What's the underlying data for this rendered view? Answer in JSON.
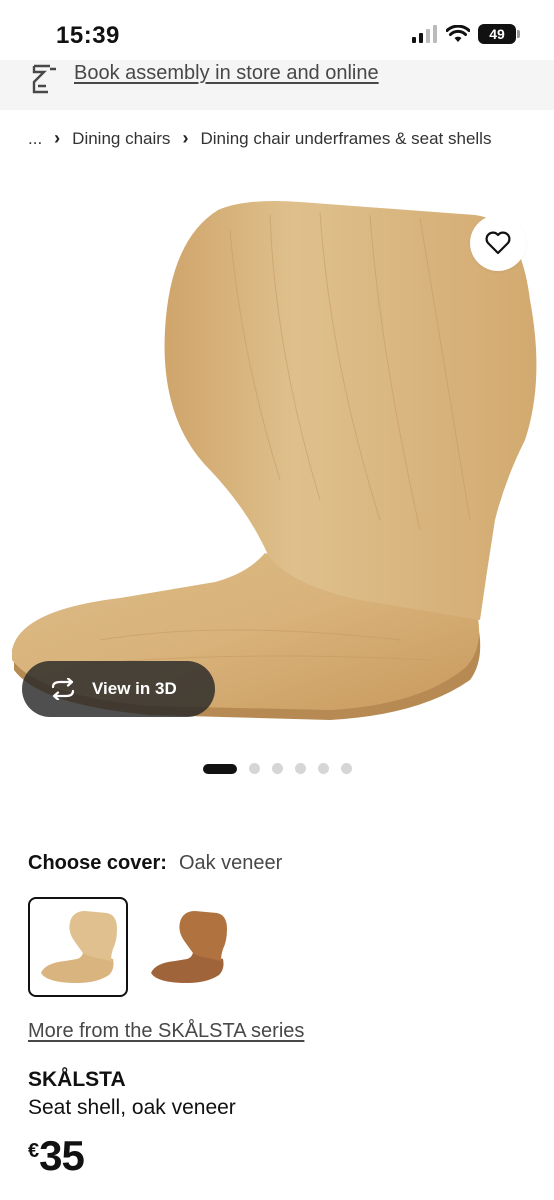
{
  "status_bar": {
    "time": "15:39",
    "battery": "49",
    "icons": [
      "signal-icon",
      "wifi-icon",
      "battery-icon"
    ]
  },
  "assembly": {
    "icon": "assembly-icon",
    "link": "Book assembly in store and online"
  },
  "breadcrumb": {
    "ellipsis": "...",
    "items": [
      "Dining chairs",
      "Dining chair underframes & seat shells"
    ]
  },
  "gallery": {
    "wishlist_icon": "heart-icon",
    "view3d_label": "View in 3D",
    "view3d_icon": "rotate-3d-icon",
    "total_images": 6,
    "active_index": 0
  },
  "cover": {
    "label": "Choose cover:",
    "value": "Oak veneer",
    "options": [
      "oak-veneer",
      "walnut-veneer"
    ],
    "selected": 0
  },
  "series_link": "More from the SKÅLSTA series",
  "product": {
    "name": "SKÅLSTA",
    "description": "Seat shell, oak veneer",
    "currency": "€",
    "price": "35"
  },
  "colors": {
    "oak": "#d9b47e",
    "walnut": "#a86a3c",
    "text": "#111111",
    "muted": "#484848",
    "banner_bg": "#f5f5f5"
  }
}
